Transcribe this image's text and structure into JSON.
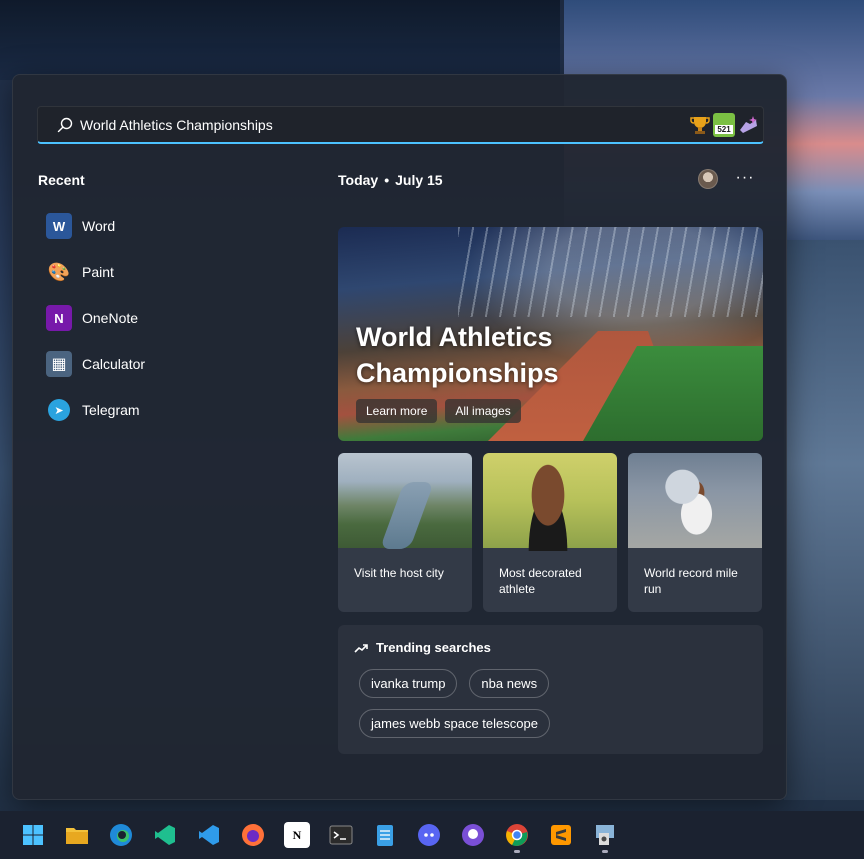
{
  "search": {
    "value": "World Athletics Championships",
    "badge": "521"
  },
  "recent": {
    "title": "Recent",
    "items": [
      {
        "label": "Word",
        "icon": "word-icon",
        "color": "#2b579a",
        "glyph": "W"
      },
      {
        "label": "Paint",
        "icon": "paint-icon",
        "color": "#3a8ee6",
        "glyph": "🎨"
      },
      {
        "label": "OneNote",
        "icon": "onenote-icon",
        "color": "#7719aa",
        "glyph": "N"
      },
      {
        "label": "Calculator",
        "icon": "calculator-icon",
        "color": "#4b6480",
        "glyph": "▦"
      },
      {
        "label": "Telegram",
        "icon": "telegram-icon",
        "color": "#2aa3df",
        "glyph": "➤"
      }
    ]
  },
  "header": {
    "today": "Today",
    "dot": "•",
    "date": "July 15",
    "more": "···"
  },
  "hero": {
    "title": "World Athletics Championships",
    "learn_more": "Learn more",
    "all_images": "All images"
  },
  "cards": [
    {
      "caption": "Visit the host city"
    },
    {
      "caption": "Most decorated athlete"
    },
    {
      "caption": "World record mile run"
    }
  ],
  "trending": {
    "title": "Trending searches",
    "chips": [
      "ivanka trump",
      "nba news",
      "james webb space telescope"
    ]
  },
  "taskbar": {
    "notion_glyph": "N"
  },
  "colors": {
    "accent": "#4cc2ff",
    "panel": "#202632",
    "card": "#333a47"
  }
}
